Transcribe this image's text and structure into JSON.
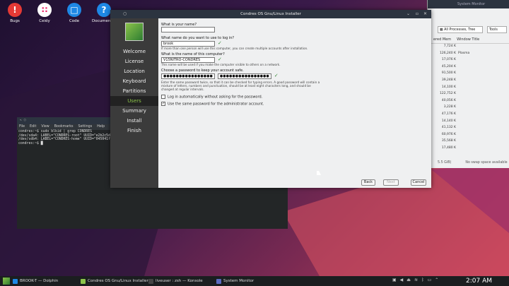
{
  "desktop": {
    "icons": [
      {
        "label": "Bugs",
        "color": "#e53935",
        "glyph": "!"
      },
      {
        "label": "Ceidy",
        "color": "#ffffff",
        "glyph": "∷"
      },
      {
        "label": "Code",
        "color": "#1e88e5",
        "glyph": "□"
      },
      {
        "label": "Documentat",
        "color": "#1e88e5",
        "glyph": "?"
      }
    ]
  },
  "sysmon": {
    "title": "System Monitor",
    "filter": "All Processes, Tree",
    "tools": "Tools",
    "col_mem": "ered Mem",
    "col_title": "Window Title",
    "rows": [
      {
        "mem": "7,724 K",
        "title": ""
      },
      {
        "mem": "126,240 K",
        "title": "Plasma"
      },
      {
        "mem": "17,076 K",
        "title": ""
      },
      {
        "mem": "45,204 K",
        "title": ""
      },
      {
        "mem": "91,500 K",
        "title": ""
      },
      {
        "mem": "39,248 K",
        "title": ""
      },
      {
        "mem": "14,100 K",
        "title": ""
      },
      {
        "mem": "122,752 K",
        "title": ""
      },
      {
        "mem": "40,056 K",
        "title": ""
      },
      {
        "mem": "3,228 K",
        "title": ""
      },
      {
        "mem": "47,176 K",
        "title": ""
      },
      {
        "mem": "14,140 K",
        "title": ""
      },
      {
        "mem": "41,132 K",
        "title": ""
      },
      {
        "mem": "60,976 K",
        "title": ""
      },
      {
        "mem": "35,568 K",
        "title": ""
      },
      {
        "mem": "17,480 K",
        "title": ""
      }
    ],
    "status_left": "5.5 GiB)",
    "status_right": "No swap space available"
  },
  "installer": {
    "title": "Condres OS Gnu/Linux Installer",
    "steps": [
      "Welcome",
      "License",
      "Location",
      "Keyboard",
      "Partitions",
      "Users",
      "Summary",
      "Install",
      "Finish"
    ],
    "active_step": "Users",
    "q_name": "What is your name?",
    "name_value": "",
    "q_login": "What name do you want to use to log in?",
    "login_value": "brook",
    "login_hint": "If more than one person will use this computer, you can create multiple accounts after installation.",
    "q_computer": "What is the name of this computer?",
    "computer_value": "V15NITRO-CONDRES",
    "computer_hint": "This name will be used if you make the computer visible to others on a network.",
    "q_password": "Choose a password to keep your account safe.",
    "password_value": "●●●●●●●●●●●●●●●●",
    "password_confirm": "●●●●●●●●●●●●●●●●",
    "password_hint": "Enter the same password twice, so that it can be checked for typing errors. A good password will contain a mixture of letters, numbers and punctuation, should be at least eight characters long, and should be changed at regular intervals.",
    "autologin_label": "Log in automatically without asking for the password.",
    "autologin_checked": false,
    "samepw_label": "Use the same password for the administrator account.",
    "samepw_checked": true,
    "back": "Back",
    "next": "Next",
    "cancel": "Cancel"
  },
  "konsole": {
    "menu": [
      "File",
      "Edit",
      "View",
      "Bookmarks",
      "Settings",
      "Help"
    ],
    "lines": [
      "condres:~$ sudo blkid | grep CONDRES",
      "/dev/sda4: LABEL=\"CONDRES-root\" UUID=\"e2b2c5d8-880c",
      "/dev/sdb4: LABEL=\"CONDRES-home\" UUID=\"045041fa-5050",
      "condres:~$ "
    ]
  },
  "taskbar": {
    "items": [
      {
        "label": "BROOK-T — Dolphin",
        "color": "#1e88e5"
      },
      {
        "label": "Condres OS Gnu/Linux Installer",
        "color": "#8bc34a"
      },
      {
        "label": "liveuser : zsh — Konsole",
        "color": "#444"
      },
      {
        "label": "System Monitor",
        "color": "#5c6bc0"
      }
    ],
    "clock": "2:07 AM"
  }
}
